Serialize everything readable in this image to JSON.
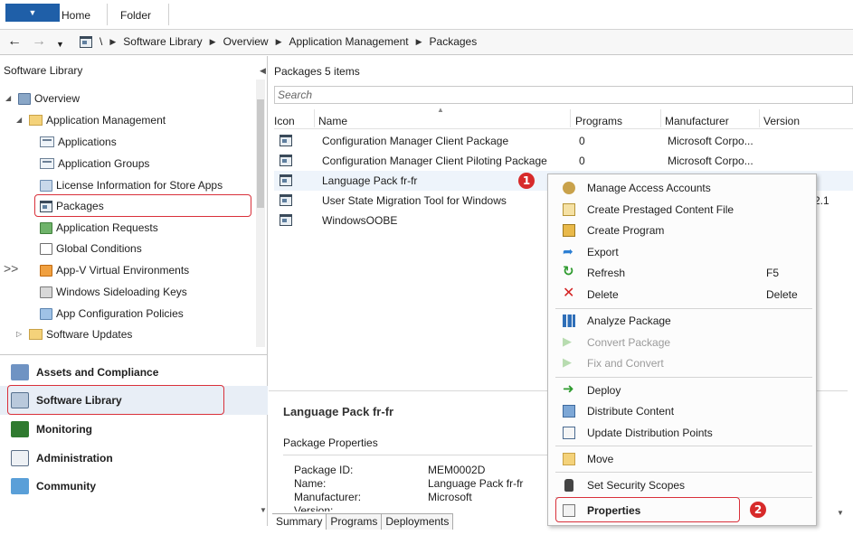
{
  "ribbon": {
    "tabs": [
      "Home",
      "Folder"
    ]
  },
  "addressbar": {
    "path": [
      "\\",
      "Software Library",
      "Overview",
      "Application Management",
      "Packages"
    ]
  },
  "left_pane": {
    "title": "Software Library",
    "tree": [
      {
        "label": "Overview",
        "icon": "overview-icon"
      },
      {
        "label": "Application Management",
        "icon": "folder-icon"
      },
      {
        "label": "Applications",
        "icon": "applications-icon"
      },
      {
        "label": "Application Groups",
        "icon": "application-groups-icon"
      },
      {
        "label": "License Information for Store Apps",
        "icon": "license-icon"
      },
      {
        "label": "Packages",
        "icon": "package-icon"
      },
      {
        "label": "Application Requests",
        "icon": "application-requests-icon"
      },
      {
        "label": "Global Conditions",
        "icon": "global-conditions-icon"
      },
      {
        "label": "App-V Virtual Environments",
        "icon": "appv-icon"
      },
      {
        "label": "Windows Sideloading Keys",
        "icon": "keys-icon"
      },
      {
        "label": "App Configuration Policies",
        "icon": "policies-icon"
      },
      {
        "label": "Software Updates",
        "icon": "folder-icon"
      }
    ],
    "workspaces": [
      "Assets and Compliance",
      "Software Library",
      "Monitoring",
      "Administration",
      "Community"
    ],
    "collapse_glyph": ">>"
  },
  "content": {
    "heading": "Packages 5 items",
    "search_placeholder": "Search",
    "columns": [
      "Icon",
      "Name",
      "Programs",
      "Manufacturer",
      "Version"
    ],
    "rows": [
      {
        "name": "Configuration Manager Client Package",
        "programs": "0",
        "manufacturer": "Microsoft Corpo...",
        "version": ""
      },
      {
        "name": "Configuration Manager Client Piloting Package",
        "programs": "0",
        "manufacturer": "Microsoft Corpo...",
        "version": ""
      },
      {
        "name": "Language Pack fr-fr",
        "programs": "",
        "manufacturer": "",
        "version": ""
      },
      {
        "name": "User State Migration Tool for Windows",
        "programs": "",
        "manufacturer": "",
        "version": "2.1"
      },
      {
        "name": "WindowsOOBE",
        "programs": "",
        "manufacturer": "",
        "version": ""
      }
    ]
  },
  "detail": {
    "title": "Language Pack fr-fr",
    "section": "Package Properties",
    "properties": [
      {
        "key": "Package ID:",
        "value": "MEM0002D"
      },
      {
        "key": "Name:",
        "value": "Language Pack fr-fr"
      },
      {
        "key": "Manufacturer:",
        "value": "Microsoft"
      },
      {
        "key": "Version:",
        "value": ""
      }
    ],
    "tabs": [
      "Summary",
      "Programs",
      "Deployments"
    ]
  },
  "context_menu": {
    "items": [
      {
        "label": "Manage Access Accounts",
        "icon": "manage-accounts-icon",
        "shortcut": "",
        "disabled": false
      },
      {
        "label": "Create Prestaged Content File",
        "icon": "prestaged-icon",
        "shortcut": "",
        "disabled": false
      },
      {
        "label": "Create Program",
        "icon": "create-program-icon",
        "shortcut": "",
        "disabled": false
      },
      {
        "label": "Export",
        "icon": "export-icon",
        "shortcut": "",
        "disabled": false
      },
      {
        "label": "Refresh",
        "icon": "refresh-icon",
        "shortcut": "F5",
        "disabled": false
      },
      {
        "label": "Delete",
        "icon": "delete-icon",
        "shortcut": "Delete",
        "disabled": false
      },
      {
        "label": "Analyze Package",
        "icon": "analyze-icon",
        "shortcut": "",
        "disabled": false
      },
      {
        "label": "Convert Package",
        "icon": "convert-icon",
        "shortcut": "",
        "disabled": true
      },
      {
        "label": "Fix and Convert",
        "icon": "fix-convert-icon",
        "shortcut": "",
        "disabled": true
      },
      {
        "label": "Deploy",
        "icon": "deploy-icon",
        "shortcut": "",
        "disabled": false
      },
      {
        "label": "Distribute Content",
        "icon": "distribute-icon",
        "shortcut": "",
        "disabled": false
      },
      {
        "label": "Update Distribution Points",
        "icon": "update-dp-icon",
        "shortcut": "",
        "disabled": false
      },
      {
        "label": "Move",
        "icon": "move-icon",
        "shortcut": "",
        "disabled": false
      },
      {
        "label": "Set Security Scopes",
        "icon": "security-scopes-icon",
        "shortcut": "",
        "disabled": false
      },
      {
        "label": "Properties",
        "icon": "properties-icon",
        "shortcut": "",
        "disabled": false
      }
    ]
  },
  "annotations": {
    "badge_1": "1",
    "badge_2": "2"
  },
  "colors": {
    "highlight": "#d9303a",
    "badge": "#d72a2a",
    "accent": "#1f5fa8"
  }
}
